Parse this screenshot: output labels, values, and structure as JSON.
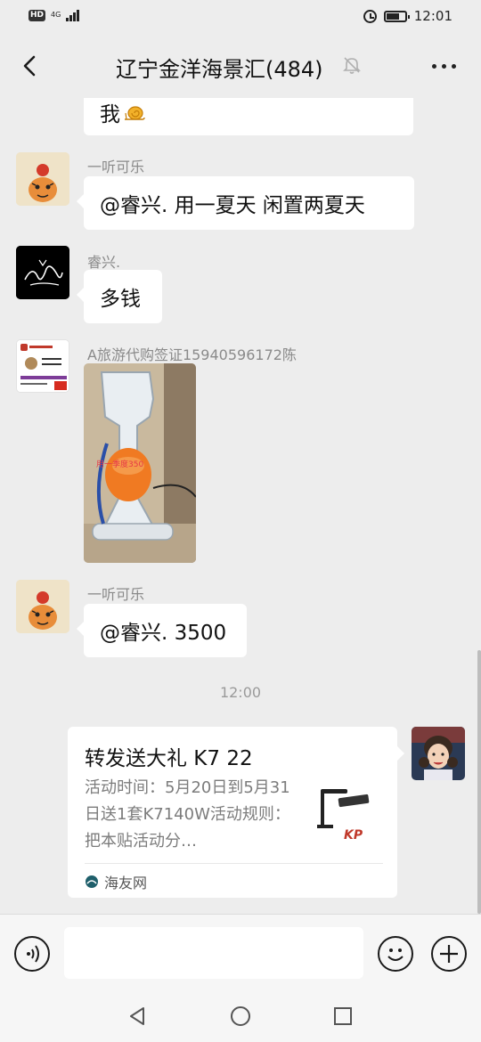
{
  "status_bar": {
    "hd": "HD",
    "network": "4G",
    "time": "12:01"
  },
  "header": {
    "title": "辽宁金洋海景汇(484)"
  },
  "messages": [
    {
      "text": "我"
    },
    {
      "sender": "一听可乐",
      "text": "@睿兴. 用一夏天 闲置两夏天"
    },
    {
      "sender": "睿兴.",
      "text": "多钱"
    },
    {
      "sender": "A旅游代购签证15940596172陈",
      "image_caption": "用一季度350"
    },
    {
      "sender": "一听可乐",
      "text": "@睿兴. 3500"
    }
  ],
  "time_divider": "12:00",
  "shared_card": {
    "title": "转发送大礼 K7 22",
    "description": "活动时间：5月20日到5月31日送1套K7140W活动规则：把本贴活动分…",
    "source": "海友网"
  },
  "colors": {
    "background": "#ededed",
    "bubble": "#ffffff",
    "card_thumb_accent": "#c0392b"
  }
}
